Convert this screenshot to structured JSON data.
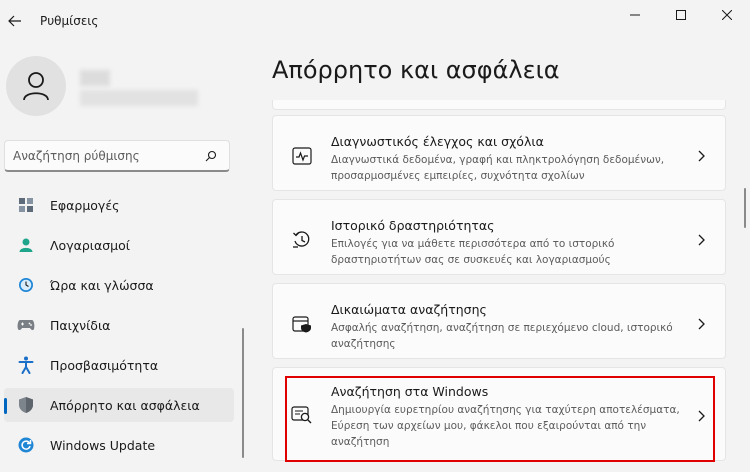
{
  "window": {
    "title": "Ρυθμίσεις"
  },
  "search": {
    "placeholder": "Αναζήτηση ρύθμισης"
  },
  "nav": {
    "items": [
      {
        "label": "Εφαρμογές",
        "icon": "apps-icon"
      },
      {
        "label": "Λογαριασμοί",
        "icon": "accounts-icon"
      },
      {
        "label": "Ώρα και γλώσσα",
        "icon": "time-language-icon"
      },
      {
        "label": "Παιχνίδια",
        "icon": "gaming-icon"
      },
      {
        "label": "Προσβασιμότητα",
        "icon": "accessibility-icon"
      },
      {
        "label": "Απόρρητο και ασφάλεια",
        "icon": "shield-icon",
        "selected": true
      },
      {
        "label": "Windows Update",
        "icon": "windows-update-icon"
      }
    ]
  },
  "page": {
    "title": "Απόρρητο και ασφάλεια"
  },
  "cards": [
    {
      "title": "Διαγνωστικός έλεγχος και σχόλια",
      "desc": "Διαγνωστικά δεδομένα, γραφή και πληκτρολόγηση δεδομένων, προσαρμοσμένες εμπειρίες, συχνότητα σχολίων",
      "icon": "diagnostics-icon"
    },
    {
      "title": "Ιστορικό δραστηριότητας",
      "desc": "Επιλογές για να μάθετε περισσότερα από το ιστορικό δραστηριοτήτων σας σε συσκευές και λογαριασμούς",
      "icon": "history-icon"
    },
    {
      "title": "Δικαιώματα αναζήτησης",
      "desc": "Ασφαλής αναζήτηση, αναζήτηση σε περιεχόμενο cloud, ιστορικό αναζήτησης",
      "icon": "search-permissions-icon"
    },
    {
      "title": "Αναζήτηση στα Windows",
      "desc": "Δημιουργία ευρετηρίου αναζήτησης για ταχύτερη αποτελέσματα, Εύρεση των αρχείων μου, φάκελοι που εξαιρούνται από την αναζήτηση",
      "icon": "windows-search-icon",
      "highlighted": true
    }
  ],
  "colors": {
    "accent": "#0067c0",
    "highlight": "#e00000",
    "background": "#f3f3f3",
    "card": "#fbfbfb"
  }
}
